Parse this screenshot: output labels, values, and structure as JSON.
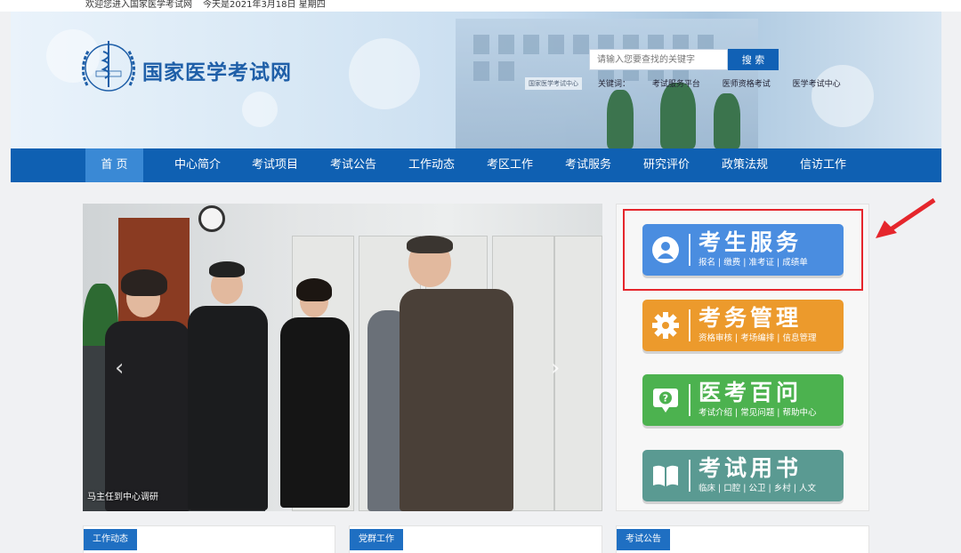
{
  "topbar": {
    "welcome": "欢迎您进入国家医学考试网",
    "date": "今天是2021年3月18日 星期四"
  },
  "header": {
    "site_name": "国家医学考试网",
    "building_sign": "国家医学考试中心",
    "search_placeholder": "请输入您要查找的关键字",
    "search_button": "搜 索",
    "hot_keys_label": "关键词：",
    "hot_keys": [
      "考试服务平台",
      "医师资格考试",
      "医学考试中心"
    ]
  },
  "nav": {
    "items": [
      "首 页",
      "中心简介",
      "考试项目",
      "考试公告",
      "工作动态",
      "考区工作",
      "考试服务",
      "研究评价",
      "政策法规",
      "信访工作"
    ],
    "active_index": 0
  },
  "slider": {
    "caption": "马主任到中心调研",
    "prev_icon": "chevron-left-icon",
    "next_icon": "chevron-right-icon"
  },
  "services": [
    {
      "title": "考生服务",
      "subtitle": "报名 | 缴费 | 准考证 | 成绩单",
      "color": "#4a8de0",
      "icon": "user-icon"
    },
    {
      "title": "考务管理",
      "subtitle": "资格审核 | 考场编排 | 信息管理",
      "color": "#ec9a2c",
      "icon": "gear-icon"
    },
    {
      "title": "医考百问",
      "subtitle": "考试介绍 | 常见问题 | 帮助中心",
      "color": "#4cb24f",
      "icon": "question-chat-icon"
    },
    {
      "title": "考试用书",
      "subtitle": "临床 | 口腔 | 公卫 | 乡村 | 人文",
      "color": "#5a9a92",
      "icon": "book-icon"
    }
  ],
  "sections": [
    "工作动态",
    "党群工作",
    "考试公告"
  ],
  "colors": {
    "nav_bg": "#0f60b2",
    "nav_active": "#3a89d5",
    "highlight": "#e5262c",
    "section_tag": "#1f6fc2"
  }
}
